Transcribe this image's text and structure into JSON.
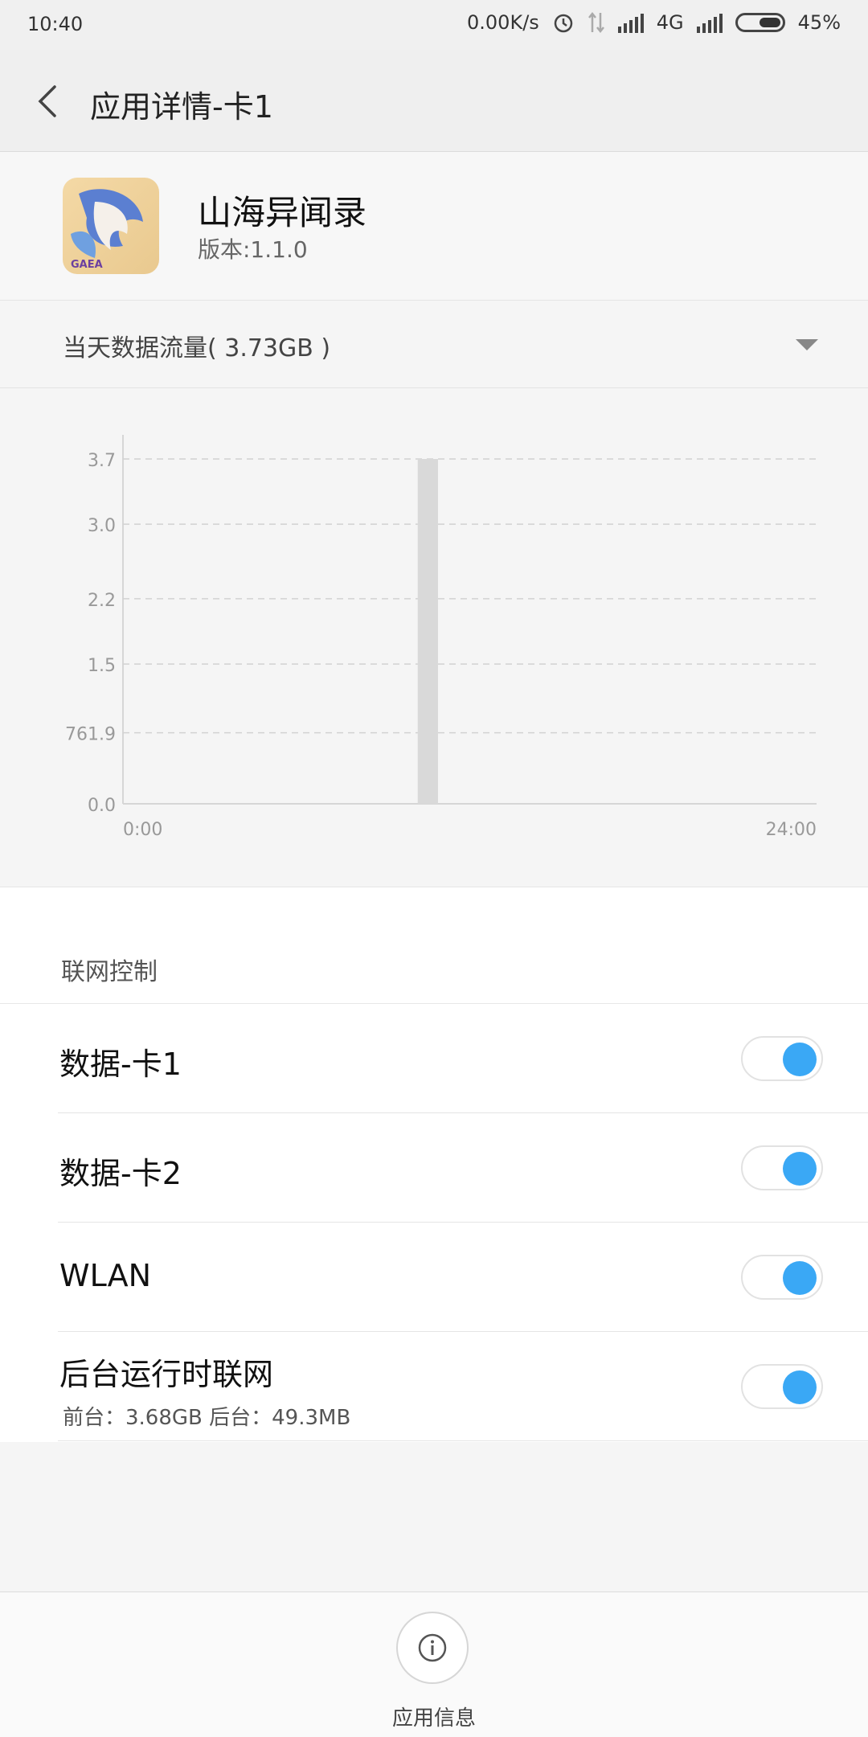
{
  "status_bar": {
    "time": "10:40",
    "net_speed": "0.00K/s",
    "network_type": "4G",
    "battery": "45%",
    "icons": [
      "alarm-icon",
      "data-arrows-icon",
      "signal-icon",
      "signal-icon",
      "battery-icon"
    ]
  },
  "header": {
    "title": "应用详情-卡1",
    "back_icon": "chevron-left-icon"
  },
  "app": {
    "name": "山海异闻录",
    "version": "版本:1.1.0",
    "icon_text": "GAEA"
  },
  "usage": {
    "label": "当天数据流量( 3.73GB )",
    "dropdown_icon": "triangle-down-icon"
  },
  "chart_data": {
    "type": "bar",
    "title": "",
    "xlabel": "",
    "ylabel": "",
    "x_ticks": [
      "0:00",
      "24:00"
    ],
    "y_ticks": [
      "0.0",
      "761.9",
      "1.5",
      "2.2",
      "3.0",
      "3.7"
    ],
    "y_tick_values": [
      0,
      0.7619,
      1.5,
      2.2,
      3.0,
      3.7
    ],
    "x_range": [
      0,
      24
    ],
    "ylim": [
      0,
      3.7
    ],
    "grid": true,
    "bars": [
      {
        "x_start": 10.2,
        "x_end": 10.9,
        "value": 3.7
      }
    ],
    "bar_color": "#d9d9d9"
  },
  "network_control": {
    "title": "联网控制",
    "rows": [
      {
        "label": "数据-卡1",
        "enabled": true
      },
      {
        "label": "数据-卡2",
        "enabled": true
      },
      {
        "label": "WLAN",
        "enabled": true
      },
      {
        "label": "后台运行时联网",
        "sub": "前台：3.68GB   后台：49.3MB",
        "enabled": true
      }
    ]
  },
  "footer": {
    "label": "应用信息",
    "icon": "info-icon"
  },
  "colors": {
    "toggle_on": "#3aa8f5",
    "background": "#f5f5f5"
  }
}
